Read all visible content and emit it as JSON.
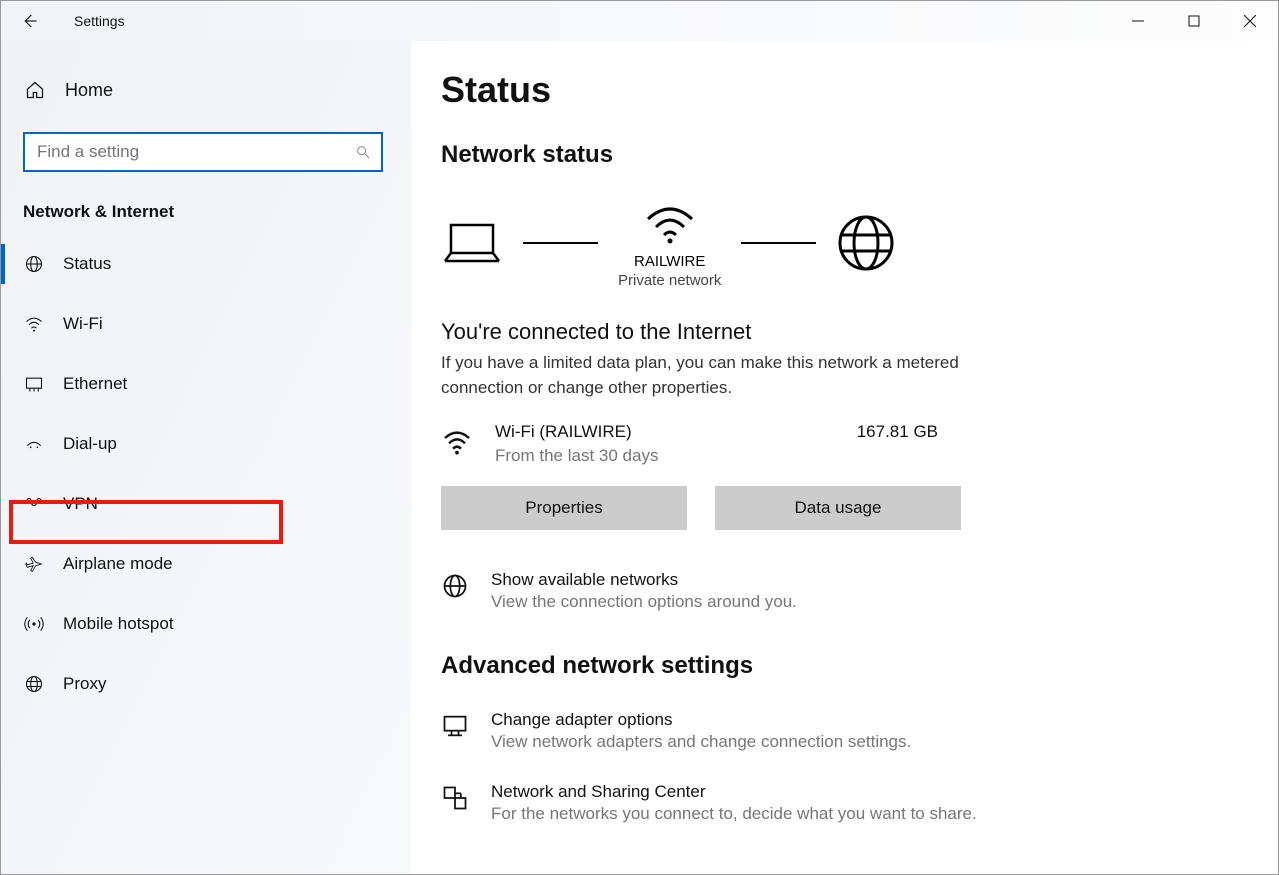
{
  "app_title": "Settings",
  "home_label": "Home",
  "search_placeholder": "Find a setting",
  "category": "Network & Internet",
  "nav": [
    {
      "label": "Status"
    },
    {
      "label": "Wi-Fi"
    },
    {
      "label": "Ethernet"
    },
    {
      "label": "Dial-up"
    },
    {
      "label": "VPN"
    },
    {
      "label": "Airplane mode"
    },
    {
      "label": "Mobile hotspot"
    },
    {
      "label": "Proxy"
    }
  ],
  "page_title": "Status",
  "section1": "Network status",
  "diagram": {
    "name": "RAILWIRE",
    "sub": "Private network"
  },
  "headline": "You're connected to the Internet",
  "headline_sub": "If you have a limited data plan, you can make this network a metered connection or change other properties.",
  "connection": {
    "name": "Wi-Fi (RAILWIRE)",
    "sub": "From the last 30 days",
    "data": "167.81 GB"
  },
  "btn_properties": "Properties",
  "btn_datausage": "Data usage",
  "show_networks": {
    "title": "Show available networks",
    "sub": "View the connection options around you."
  },
  "section2": "Advanced network settings",
  "adapter": {
    "title": "Change adapter options",
    "sub": "View network adapters and change connection settings."
  },
  "sharing": {
    "title": "Network and Sharing Center",
    "sub": "For the networks you connect to, decide what you want to share."
  }
}
